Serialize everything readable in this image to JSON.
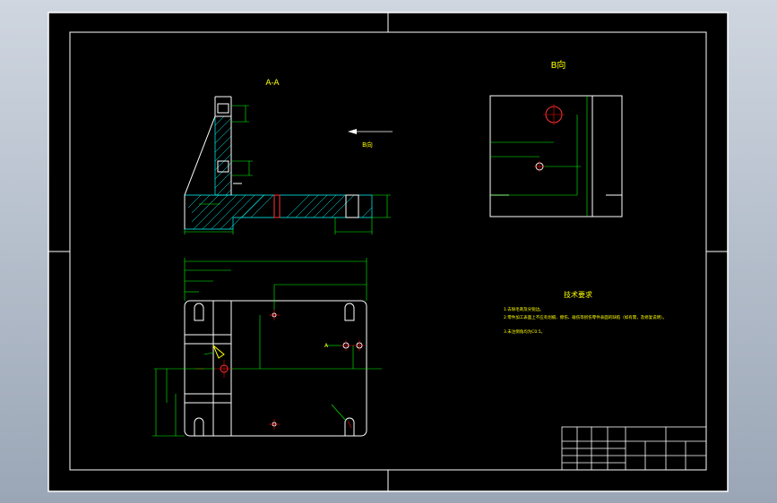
{
  "views": {
    "section_title": "A-A",
    "view_title": "B向",
    "arrow_label": "B向",
    "section_marker": "A"
  },
  "requirements": {
    "title": "技术要求",
    "items": [
      "1.去除毛刺及尖锐边。",
      "2.零件加工表面上不应有划痕、擦伤、碰伤等损伤零件表面的缺陷（如有需，及修复说明）。",
      "3.未注倒角均为C0.5。"
    ]
  },
  "colors": {
    "background": "#000000",
    "frame": "#ffffff",
    "geometry": "#ffffff",
    "dimension": "#00ff00",
    "centerline": "#ff0000",
    "text": "#ffff00",
    "hatch": "#00ffff"
  }
}
